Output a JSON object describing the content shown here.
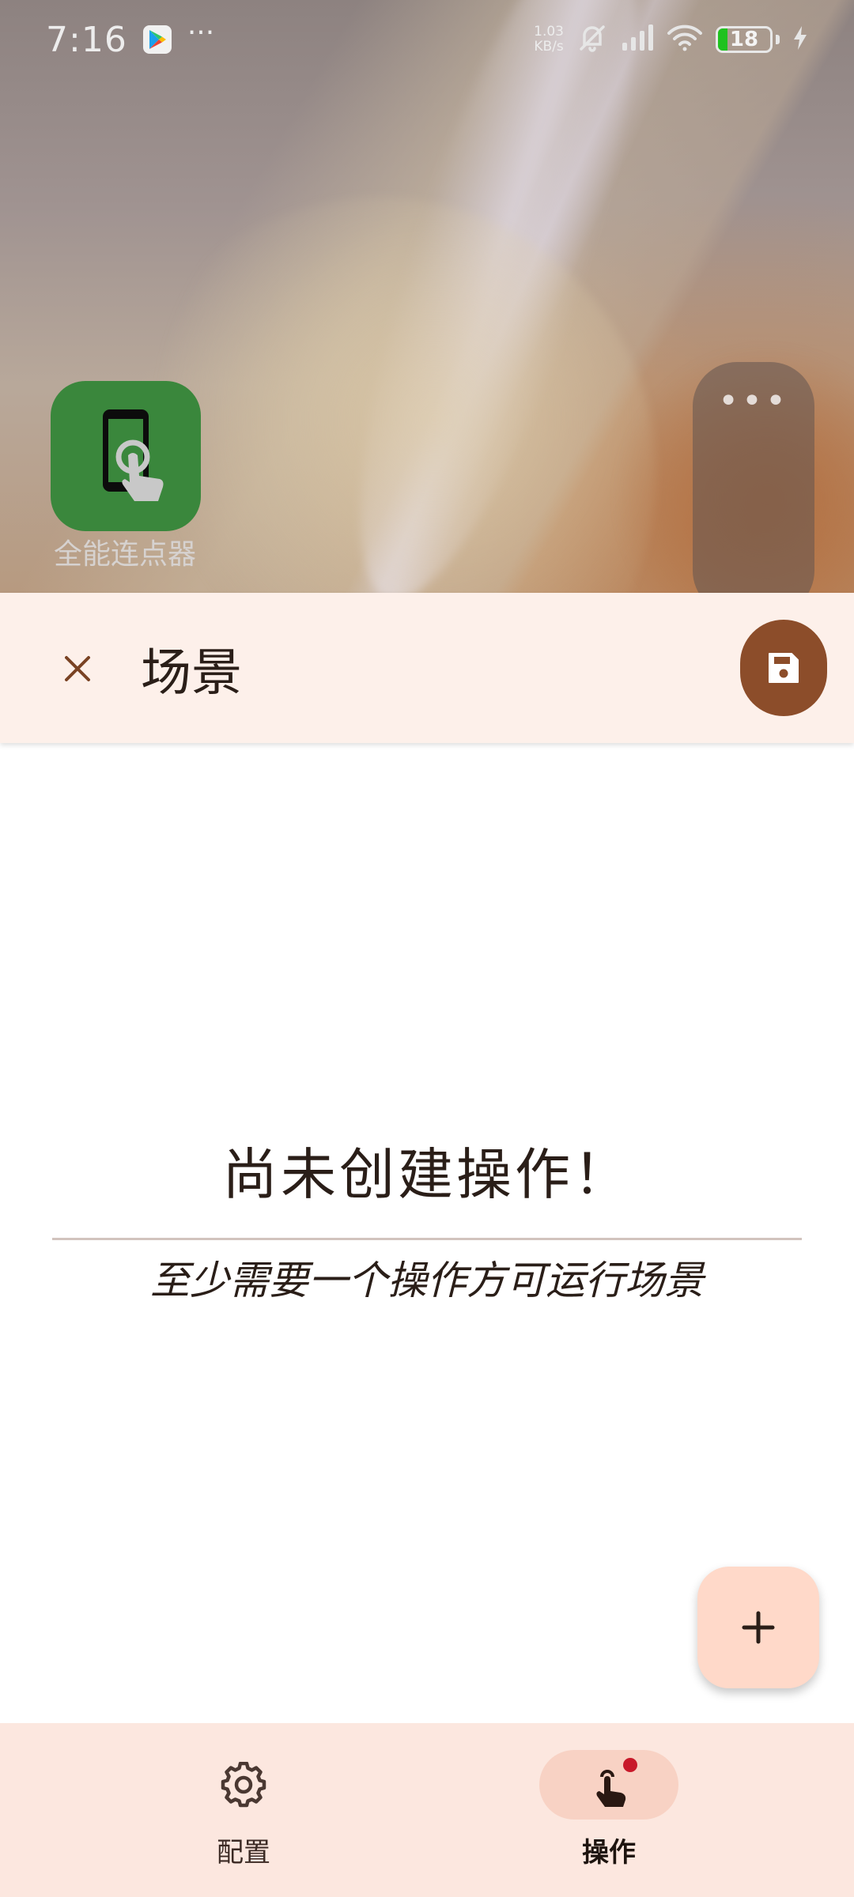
{
  "status_bar": {
    "time": "7:16",
    "overflow": "···",
    "net_speed_value": "1.03",
    "net_speed_unit": "KB/s",
    "battery_level": "18",
    "icons": [
      "play-store-icon",
      "mute-bell-icon",
      "signal-icon",
      "wifi-icon",
      "battery-icon",
      "charging-bolt-icon"
    ]
  },
  "home_screen": {
    "app_label": "全能连点器",
    "pill_dots": "•••"
  },
  "top_bar": {
    "title": "场景",
    "close_icon": "close-icon",
    "save_icon": "save-icon"
  },
  "empty_state": {
    "title": "尚未创建操作！",
    "subtitle": "至少需要一个操作方可运行场景"
  },
  "fab": {
    "icon": "plus-icon"
  },
  "bottom_nav": {
    "items": [
      {
        "label": "配置",
        "icon": "gear-icon",
        "selected": false
      },
      {
        "label": "操作",
        "icon": "touch-hand-icon",
        "selected": true,
        "badge": true
      }
    ]
  },
  "colors": {
    "accent": "#8c4d2a",
    "top_bar_bg": "#fdf0ea",
    "fab_bg": "#ffd9c9",
    "nav_bg": "#fce7df",
    "nav_selected_pill": "#f8d2c4",
    "badge": "#c8192a",
    "app_icon_bg": "#3a873c"
  }
}
